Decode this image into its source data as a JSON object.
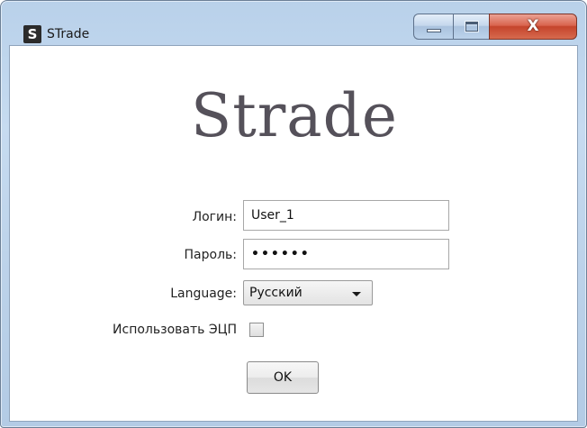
{
  "window": {
    "title": "STrade",
    "app_icon_letter": "S",
    "close_glyph": "X"
  },
  "brand": {
    "text": "Strade"
  },
  "form": {
    "login_label": "Логин:",
    "login_value": "User_1",
    "password_label": "Пароль:",
    "password_value": "••••••",
    "language_label": "Language:",
    "language_selected": "Русский",
    "digital_signature_label": "Использовать ЭЦП",
    "digital_signature_checked": false,
    "ok_label": "OK"
  },
  "colors": {
    "frame": "#bcd3ea",
    "close_button": "#d9654f",
    "brand_text": "#55515a"
  }
}
